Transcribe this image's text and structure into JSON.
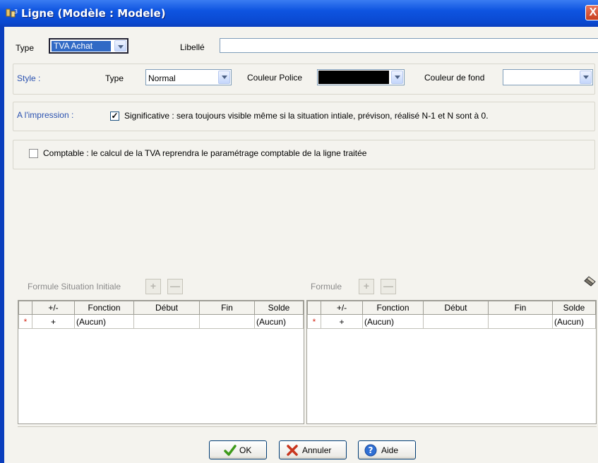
{
  "window": {
    "title": "Ligne (Modèle : Modele)",
    "close": "X"
  },
  "header": {
    "type_label": "Type",
    "type_value": "TVA Achat",
    "libelle_label": "Libellé",
    "libelle_value": ""
  },
  "style": {
    "section_label": "Style :",
    "type_label": "Type",
    "type_value": "Normal",
    "font_color_label": "Couleur Police",
    "font_color_value": "#000000",
    "bg_color_label": "Couleur de fond",
    "bg_color_value": "#ffffff"
  },
  "print": {
    "section_label": "A l'impression :",
    "significative_checked": true,
    "significative_label": "Significative : sera toujours visible même si la situation intiale, prévison, réalisé N-1 et N sont à 0.",
    "check_mark": "✓"
  },
  "comptable": {
    "checked": false,
    "label": "Comptable : le calcul de la TVA reprendra le paramétrage comptable de la ligne traitée"
  },
  "formule_initiale": {
    "label": "Formule Situation Initiale",
    "add": "+",
    "remove": "—",
    "columns": [
      "",
      "+/-",
      "Fonction",
      "Début",
      "Fin",
      "Solde"
    ],
    "rows": [
      [
        "*",
        "+",
        "(Aucun)",
        "",
        "",
        "(Aucun)"
      ]
    ]
  },
  "formule": {
    "label": "Formule",
    "add": "+",
    "remove": "—",
    "columns": [
      "",
      "+/-",
      "Fonction",
      "Début",
      "Fin",
      "Solde"
    ],
    "rows": [
      [
        "*",
        "+",
        "(Aucun)",
        "",
        "",
        "(Aucun)"
      ]
    ]
  },
  "buttons": {
    "ok": "OK",
    "cancel": "Annuler",
    "help": "Aide"
  },
  "colors": {
    "title_bar": "#0a48cf",
    "section_label": "#2b52b0",
    "new_row_marker": "#d42a1a"
  }
}
